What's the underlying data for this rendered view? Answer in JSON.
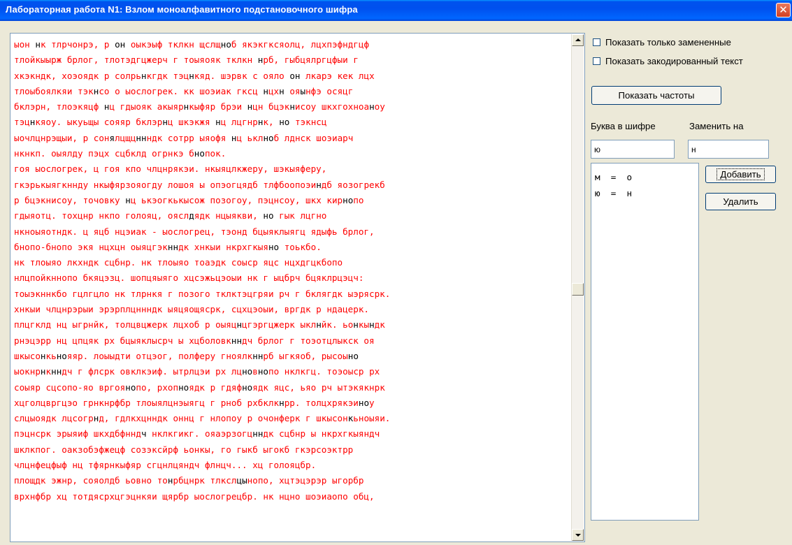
{
  "window": {
    "title": "Лабораторная работа N1: Взлом моноалфавитного подстановочного шифра",
    "close_glyph": "✕"
  },
  "text_area": {
    "lines": [
      [
        {
          "t": "ыон ",
          "c": "r"
        },
        {
          "t": "н",
          "c": "k"
        },
        {
          "t": "к тлрчонрэ, р ",
          "c": "r"
        },
        {
          "t": "он",
          "c": "k"
        },
        {
          "t": " оыкэыф тклкн щслщ",
          "c": "r"
        },
        {
          "t": "но",
          "c": "k"
        },
        {
          "t": "б якэкгксяолц, лцхпэфндгцф",
          "c": "r"
        }
      ],
      [
        {
          "t": "тлойкыырж брлог, тлотэдгцжерч г тоыяояк тклкн ",
          "c": "r"
        },
        {
          "t": "н",
          "c": "k"
        },
        {
          "t": "рб, гыбцялргцфыи г",
          "c": "r"
        }
      ],
      [
        {
          "t": "хкэкндк, хоэоядк р солрь",
          "c": "r"
        },
        {
          "t": "н",
          "c": "k"
        },
        {
          "t": "кгдк тэц",
          "c": "r"
        },
        {
          "t": "н",
          "c": "k"
        },
        {
          "t": "кяд. шэрвк с ояло ",
          "c": "r"
        },
        {
          "t": "он",
          "c": "k"
        },
        {
          "t": " лкарэ кек лцх",
          "c": "r"
        }
      ],
      [
        {
          "t": "тлоыбоялкяи тэк",
          "c": "r"
        },
        {
          "t": "н",
          "c": "k"
        },
        {
          "t": "со о ыослогрек. кк шоэиак гксц ",
          "c": "r"
        },
        {
          "t": "н",
          "c": "k"
        },
        {
          "t": "цх",
          "c": "r"
        },
        {
          "t": "н",
          "c": "k"
        },
        {
          "t": " оя",
          "c": "r"
        },
        {
          "t": "ы",
          "c": "k"
        },
        {
          "t": "нфэ осяцг",
          "c": "r"
        }
      ],
      [
        {
          "t": "бклэрн, тлоэкяцф ",
          "c": "r"
        },
        {
          "t": "н",
          "c": "k"
        },
        {
          "t": "ц гдыояк акыяр",
          "c": "r"
        },
        {
          "t": "н",
          "c": "k"
        },
        {
          "t": "кыфяр брэи ",
          "c": "r"
        },
        {
          "t": "н",
          "c": "k"
        },
        {
          "t": "цн бцэк",
          "c": "r"
        },
        {
          "t": "н",
          "c": "k"
        },
        {
          "t": "исоу шкхгохноа",
          "c": "r"
        },
        {
          "t": "н",
          "c": "k"
        },
        {
          "t": "оу",
          "c": "r"
        }
      ],
      [
        {
          "t": "тэц",
          "c": "r"
        },
        {
          "t": "н",
          "c": "k"
        },
        {
          "t": "кяоу. ыкуьщы сояяр бклэр",
          "c": "r"
        },
        {
          "t": "н",
          "c": "k"
        },
        {
          "t": "ц шкэкжя ",
          "c": "r"
        },
        {
          "t": "н",
          "c": "k"
        },
        {
          "t": "ц лцгнр",
          "c": "r"
        },
        {
          "t": "н",
          "c": "k"
        },
        {
          "t": "к, ",
          "c": "r"
        },
        {
          "t": "но",
          "c": "k"
        },
        {
          "t": " тэкнсц",
          "c": "r"
        }
      ],
      [
        {
          "t": "ыочлцнрэщыи, р сон",
          "c": "r"
        },
        {
          "t": "я",
          "c": "k"
        },
        {
          "t": "лцщц",
          "c": "r"
        },
        {
          "t": "нн",
          "c": "k"
        },
        {
          "t": "ндк сотрр ыяофя ",
          "c": "r"
        },
        {
          "t": "н",
          "c": "k"
        },
        {
          "t": "ц ькл",
          "c": "r"
        },
        {
          "t": "но",
          "c": "k"
        },
        {
          "t": "б лднск шоэиарч",
          "c": "r"
        }
      ],
      [
        {
          "t": "нкнкп. оыялду пэцх сцбклд огрнкэ б",
          "c": "r"
        },
        {
          "t": "но",
          "c": "k"
        },
        {
          "t": "пок.",
          "c": "r"
        }
      ],
      [
        {
          "t": "гоя ыослогрек, ц гоя кпо члцнрякэи. нкыяцлкжеру, шэкыяферу,",
          "c": "r"
        }
      ],
      [
        {
          "t": "гкэрькыягкннду нкыфярзояогду лошоя ы опэогцядб тлфбоопоэи",
          "c": "r"
        },
        {
          "t": "н",
          "c": "k"
        },
        {
          "t": "дб яозогрекб",
          "c": "r"
        }
      ],
      [
        {
          "t": "р бцэкнисоу, точовку ",
          "c": "r"
        },
        {
          "t": "н",
          "c": "k"
        },
        {
          "t": "ц ькэогкькысож позогоу, пэцнсоу, шкх кир",
          "c": "r"
        },
        {
          "t": "но",
          "c": "k"
        },
        {
          "t": "по",
          "c": "r"
        }
      ],
      [
        {
          "t": "гдыяотц. тохцнр нкпо голояц, оясл",
          "c": "r"
        },
        {
          "t": "д",
          "c": "k"
        },
        {
          "t": "ядк нцыякви, ",
          "c": "r"
        },
        {
          "t": "но",
          "c": "k"
        },
        {
          "t": " гык лцгно",
          "c": "r"
        }
      ],
      [
        {
          "t": "нкноыяотндк. ц яцб нцэиак - ыослогрец, тэонд бцыяклыягц ядыфь брлог,",
          "c": "r"
        }
      ],
      [
        {
          "t": "бнопо-бнопо экя нцхцн оыяцгэк",
          "c": "r"
        },
        {
          "t": "нн",
          "c": "k"
        },
        {
          "t": "дк хнкыи нкрхгкыя",
          "c": "r"
        },
        {
          "t": "но",
          "c": "k"
        },
        {
          "t": " тоькбо.",
          "c": "r"
        }
      ],
      [
        {
          "t": "нк тлоыяо лкхндк сцбнр. нк тлоыяо тоаэдк соыср яцс нцхдгцкбопо",
          "c": "r"
        }
      ],
      [
        {
          "t": "нлцпойкннопо бкяцэзц. шопцяыяго хцсэжьцэоыи нк г ыцбрч бцяклрцэцч:",
          "c": "r"
        }
      ],
      [
        {
          "t": "тоыэкннкбо гцлгцло нк тлрнкя г позого тклктэцгряи рч г бклягдк ыэрясрк.",
          "c": "r"
        }
      ],
      [
        {
          "t": "хнкыи члцнрэрыи эрэрплцннндк ыяцяощясрк, сцхцэоыи, вргдк р ндацерк.",
          "c": "r"
        }
      ],
      [
        {
          "t": "плцгклд нц ыгрнйк, толцвцжерк лцхоб р оыяц",
          "c": "r"
        },
        {
          "t": "н",
          "c": "k"
        },
        {
          "t": "цгэргцжерк ыкл",
          "c": "r"
        },
        {
          "t": "н",
          "c": "k"
        },
        {
          "t": "йк. ьо",
          "c": "r"
        },
        {
          "t": "н",
          "c": "k"
        },
        {
          "t": "кы",
          "c": "r"
        },
        {
          "t": "н",
          "c": "k"
        },
        {
          "t": "дк",
          "c": "r"
        }
      ],
      [
        {
          "t": "рнэцэрр нц цпцяк рх бцыяклысрч ы хцболовк",
          "c": "r"
        },
        {
          "t": "нн",
          "c": "k"
        },
        {
          "t": "дч брлог г тоэотцлыкск оя",
          "c": "r"
        }
      ],
      [
        {
          "t": "шкысо",
          "c": "r"
        },
        {
          "t": "н",
          "c": "k"
        },
        {
          "t": "кь",
          "c": "r"
        },
        {
          "t": "но",
          "c": "k"
        },
        {
          "t": "яяр. лоыыдти отцэог, полферу гноялк",
          "c": "r"
        },
        {
          "t": "нн",
          "c": "k"
        },
        {
          "t": "рб ыгкяоб, рысоы",
          "c": "r"
        },
        {
          "t": "но",
          "c": "k"
        }
      ],
      [
        {
          "t": "ыокнр",
          "c": "r"
        },
        {
          "t": "н",
          "c": "k"
        },
        {
          "t": "к",
          "c": "r"
        },
        {
          "t": "нн",
          "c": "k"
        },
        {
          "t": "дч г флсрк овклкэиф. ытрлцэи рх лц",
          "c": "r"
        },
        {
          "t": "но",
          "c": "k"
        },
        {
          "t": "в",
          "c": "r"
        },
        {
          "t": "но",
          "c": "k"
        },
        {
          "t": "по нклкгц. тоэоыср рх",
          "c": "r"
        }
      ],
      [
        {
          "t": "соыяр сцсопо-яо вргоя",
          "c": "r"
        },
        {
          "t": "но",
          "c": "k"
        },
        {
          "t": "по, рхоп",
          "c": "r"
        },
        {
          "t": "но",
          "c": "k"
        },
        {
          "t": "ядк р гдяф",
          "c": "r"
        },
        {
          "t": "но",
          "c": "k"
        },
        {
          "t": "ядк яцс, ьяо рч ытэкякнрк",
          "c": "r"
        }
      ],
      [
        {
          "t": "хцголцвргцэо грнкнрфбр тлоыялцнэыягц г рноб рхбклк",
          "c": "r"
        },
        {
          "t": "н",
          "c": "k"
        },
        {
          "t": "рр. толцхрякэи",
          "c": "r"
        },
        {
          "t": "но",
          "c": "k"
        },
        {
          "t": "у",
          "c": "r"
        }
      ],
      [
        {
          "t": "слцыоядк лцсогр",
          "c": "r"
        },
        {
          "t": "н",
          "c": "k"
        },
        {
          "t": "д, гдлкхцнндк оннц г нлопоу р очонферк г шкысон",
          "c": "r"
        },
        {
          "t": "к",
          "c": "k"
        },
        {
          "t": "ьноыяи.",
          "c": "r"
        }
      ],
      [
        {
          "t": "пэцнсрк эрыяиф шкхдбфннд",
          "c": "r"
        },
        {
          "t": "ч",
          "c": "k"
        },
        {
          "t": " нклкгикг. ояаэрзогц",
          "c": "r"
        },
        {
          "t": "нн",
          "c": "k"
        },
        {
          "t": "дк сцбнр ы нкрхгкыяндч",
          "c": "r"
        }
      ],
      [
        {
          "t": "шклкпог. оакзобэфжецф созэксйрф ьонкы, го гыкб ыгокб гкэрсоэктрр",
          "c": "r"
        }
      ],
      [
        {
          "t": "члцнфецфыф нц тфярнкыфяр сгцнлцяндч флнцч... хц голояцбр.",
          "c": "r"
        }
      ],
      [
        {
          "t": "площдк эжнр, сояолдб ьовно то",
          "c": "r"
        },
        {
          "t": "н",
          "c": "k"
        },
        {
          "t": "рбцнрк тлксл",
          "c": "r"
        },
        {
          "t": "цы",
          "c": "k"
        },
        {
          "t": "нопо, хцтэцэрэр ыгорбр",
          "c": "r"
        }
      ],
      [
        {
          "t": "врхнфбр хц тотдясрхцгэцнкяи щярбр ыослогрецбр. нк нцно шоэиаопо обц,",
          "c": "r"
        }
      ]
    ]
  },
  "options": {
    "show_replaced_only": "Показать только замененные",
    "show_encoded_text": "Показать закодированный текст"
  },
  "buttons": {
    "show_freq": "Показать частоты",
    "add": "Добавить",
    "delete": "Удалить"
  },
  "labels": {
    "cipher_letter": "Буква в шифре",
    "replace_with": "Заменить на"
  },
  "inputs": {
    "cipher_value": "ю",
    "replace_value": "н"
  },
  "substitutions": [
    "м  =  о",
    "ю  =  н"
  ],
  "colors": {
    "cipher_text": "#ff0000",
    "decoded_text": "#000000",
    "titlebar": "#0053ee"
  }
}
